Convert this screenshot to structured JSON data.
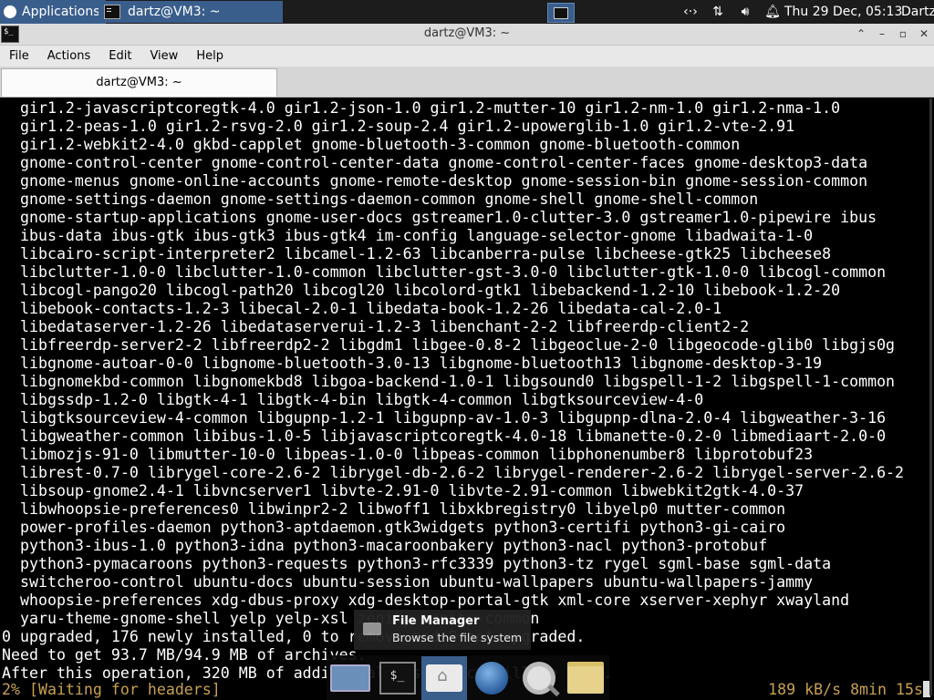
{
  "top_panel": {
    "applications_label": "Applications",
    "task_title": "dartz@VM3: ~",
    "clock": "Thu 29 Dec, 05:13",
    "user": "Dartz",
    "tray_icons": [
      "network-arrows-icon",
      "transfer-icon",
      "volume-icon",
      "notification-bell-icon"
    ]
  },
  "window": {
    "title": "dartz@VM3: ~",
    "controls": [
      "maximize-up",
      "minimize",
      "restore",
      "close"
    ]
  },
  "menubar": [
    "File",
    "Actions",
    "Edit",
    "View",
    "Help"
  ],
  "tab": {
    "label": "dartz@VM3: ~"
  },
  "terminal": {
    "lines": [
      "  gir1.2-javascriptcoregtk-4.0 gir1.2-json-1.0 gir1.2-mutter-10 gir1.2-nm-1.0 gir1.2-nma-1.0",
      "  gir1.2-peas-1.0 gir1.2-rsvg-2.0 gir1.2-soup-2.4 gir1.2-upowerglib-1.0 gir1.2-vte-2.91",
      "  gir1.2-webkit2-4.0 gkbd-capplet gnome-bluetooth-3-common gnome-bluetooth-common",
      "  gnome-control-center gnome-control-center-data gnome-control-center-faces gnome-desktop3-data",
      "  gnome-menus gnome-online-accounts gnome-remote-desktop gnome-session-bin gnome-session-common",
      "  gnome-settings-daemon gnome-settings-daemon-common gnome-shell gnome-shell-common",
      "  gnome-startup-applications gnome-user-docs gstreamer1.0-clutter-3.0 gstreamer1.0-pipewire ibus",
      "  ibus-data ibus-gtk ibus-gtk3 ibus-gtk4 im-config language-selector-gnome libadwaita-1-0",
      "  libcairo-script-interpreter2 libcamel-1.2-63 libcanberra-pulse libcheese-gtk25 libcheese8",
      "  libclutter-1.0-0 libclutter-1.0-common libclutter-gst-3.0-0 libclutter-gtk-1.0-0 libcogl-common",
      "  libcogl-pango20 libcogl-path20 libcogl20 libcolord-gtk1 libebackend-1.2-10 libebook-1.2-20",
      "  libebook-contacts-1.2-3 libecal-2.0-1 libedata-book-1.2-26 libedata-cal-2.0-1",
      "  libedataserver-1.2-26 libedataserverui-1.2-3 libenchant-2-2 libfreerdp-client2-2",
      "  libfreerdp-server2-2 libfreerdp2-2 libgdm1 libgee-0.8-2 libgeoclue-2-0 libgeocode-glib0 libgjs0g",
      "  libgnome-autoar-0-0 libgnome-bluetooth-3.0-13 libgnome-bluetooth13 libgnome-desktop-3-19",
      "  libgnomekbd-common libgnomekbd8 libgoa-backend-1.0-1 libgsound0 libgspell-1-2 libgspell-1-common",
      "  libgssdp-1.2-0 libgtk-4-1 libgtk-4-bin libgtk-4-common libgtksourceview-4-0",
      "  libgtksourceview-4-common libgupnp-1.2-1 libgupnp-av-1.0-3 libgupnp-dlna-2.0-4 libgweather-3-16",
      "  libgweather-common libibus-1.0-5 libjavascriptcoregtk-4.0-18 libmanette-0.2-0 libmediaart-2.0-0",
      "  libmozjs-91-0 libmutter-10-0 libpeas-1.0-0 libpeas-common libphonenumber8 libprotobuf23",
      "  librest-0.7-0 librygel-core-2.6-2 librygel-db-2.6-2 librygel-renderer-2.6-2 librygel-server-2.6-2",
      "  libsoup-gnome2.4-1 libvncserver1 libvte-2.91-0 libvte-2.91-common libwebkit2gtk-4.0-37",
      "  libwhoopsie-preferences0 libwinpr2-2 libwoff1 libxkbregistry0 libyelp0 mutter-common",
      "  power-profiles-daemon python3-aptdaemon.gtk3widgets python3-certifi python3-gi-cairo",
      "  python3-ibus-1.0 python3-idna python3-macaroonbakery python3-nacl python3-protobuf",
      "  python3-pymacaroons python3-requests python3-rfc3339 python3-tz rygel sgml-base sgml-data",
      "  switcheroo-control ubuntu-docs ubuntu-session ubuntu-wallpapers ubuntu-wallpapers-jammy",
      "  whoopsie-preferences xdg-dbus-proxy xdg-desktop-portal-gtk xml-core xserver-xephyr xwayland",
      "  yaru-theme-gnome-shell yelp yelp-xsl zenity zenity-common",
      "0 upgraded, 176 newly installed, 0 to remove and 0 not upgraded.",
      "Need to get 93.7 MB/94.9 MB of archives.",
      "After this operation, 320 MB of additional disk space will be used."
    ],
    "status_left": "2% [Waiting for headers]",
    "status_right": "189 kB/s 8min 15s"
  },
  "tooltip": {
    "title": "File Manager",
    "subtitle": "Browse the file system"
  },
  "dock": {
    "items": [
      "show-desktop",
      "terminal",
      "home-folder",
      "web-browser",
      "app-finder",
      "files-folder"
    ],
    "active": "home-folder",
    "terminal_glyph": "$_"
  }
}
